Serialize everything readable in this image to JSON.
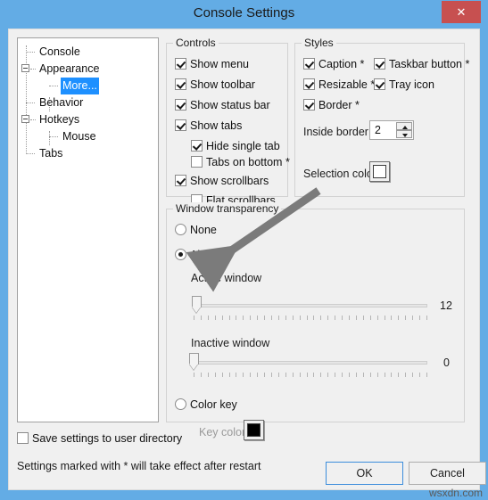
{
  "window": {
    "title": "Console Settings",
    "close_label": "✕",
    "titlebar_color": "#63ace5",
    "close_color": "#c75050",
    "body_color": "#f0f0f0",
    "accent_color": "#1e90ff"
  },
  "tree": {
    "items": [
      {
        "label": "Console",
        "depth": 0,
        "expander": false,
        "selected": false
      },
      {
        "label": "Appearance",
        "depth": 0,
        "expander": true,
        "selected": false
      },
      {
        "label": "More...",
        "depth": 1,
        "expander": false,
        "selected": true
      },
      {
        "label": "Behavior",
        "depth": 0,
        "expander": false,
        "selected": false
      },
      {
        "label": "Hotkeys",
        "depth": 0,
        "expander": true,
        "selected": false
      },
      {
        "label": "Mouse",
        "depth": 1,
        "expander": false,
        "selected": false
      },
      {
        "label": "Tabs",
        "depth": 0,
        "expander": false,
        "selected": false
      }
    ]
  },
  "controls": {
    "title": "Controls",
    "items": [
      {
        "label": "Show menu",
        "checked": true,
        "indent": false
      },
      {
        "label": "Show toolbar",
        "checked": true,
        "indent": false
      },
      {
        "label": "Show status bar",
        "checked": true,
        "indent": false
      },
      {
        "label": "Show tabs",
        "checked": true,
        "indent": false
      },
      {
        "label": "Hide single tab",
        "checked": true,
        "indent": true
      },
      {
        "label": "Tabs on bottom *",
        "checked": false,
        "indent": true
      },
      {
        "label": "Show scrollbars",
        "checked": true,
        "indent": false
      },
      {
        "label": "Flat scrollbars",
        "checked": false,
        "indent": true
      }
    ]
  },
  "styles": {
    "title": "Styles",
    "items": [
      {
        "label": "Caption *",
        "checked": true
      },
      {
        "label": "Taskbar button *",
        "checked": true
      },
      {
        "label": "Resizable *",
        "checked": true
      },
      {
        "label": "Tray icon",
        "checked": true
      },
      {
        "label": "Border *",
        "checked": true
      }
    ],
    "inside_border_label": "Inside border:",
    "inside_border_value": "2",
    "selection_color_label": "Selection color:",
    "selection_color_value": "#ffffff"
  },
  "transparency": {
    "title": "Window transparency",
    "mode_none": "None",
    "mode_alpha": "Alpha",
    "mode_colorkey": "Color key",
    "selected_mode": "Alpha",
    "active_window_label": "Active window",
    "active_window_value": "12",
    "inactive_window_label": "Inactive window",
    "inactive_window_value": "0",
    "key_color_label": "Key color:",
    "key_color_value": "#000000"
  },
  "footer": {
    "save_settings_label": "Save settings to user directory",
    "save_settings_checked": false,
    "restart_note": "Settings marked with * will take effect after restart",
    "ok_label": "OK",
    "cancel_label": "Cancel"
  },
  "watermark": "wsxdn.com"
}
